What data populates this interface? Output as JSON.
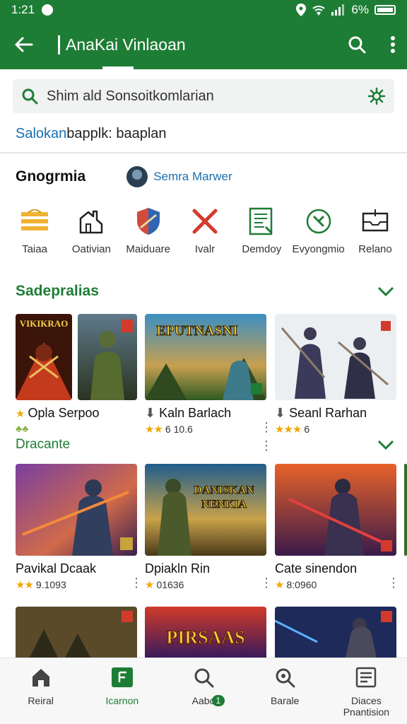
{
  "status": {
    "time": "1:21",
    "battery": "6%"
  },
  "appbar": {
    "title": "AnaKai Vinlaoan"
  },
  "search": {
    "text": "Shim ald Sonsoitkomlarian"
  },
  "suggestion": {
    "highlight": "Salokan",
    "rest": "bapplk: baaplan"
  },
  "genres": {
    "title": "Gnogrmia",
    "user": "Semra Marwer"
  },
  "categories": [
    {
      "label": "Taiaa",
      "icon": "stack-icon"
    },
    {
      "label": "Oativian",
      "icon": "building-icon"
    },
    {
      "label": "Maiduare",
      "icon": "shield-icon"
    },
    {
      "label": "Ivalr",
      "icon": "cross-swords-icon"
    },
    {
      "label": "Demdoy",
      "icon": "document-icon"
    },
    {
      "label": "Evyongmio",
      "icon": "circle-x-icon"
    },
    {
      "label": "Relano",
      "icon": "tray-icon"
    }
  ],
  "section1": {
    "title": "Sadepralias",
    "items": [
      {
        "title": "Opla Serpoo",
        "poster_text": "VIKIKRAO"
      },
      {
        "title": "Kaln Barlach",
        "rating": "6 10.6",
        "poster_text": "EPUTNASNI"
      },
      {
        "title": "Seanl Rarhan",
        "rating": "6"
      }
    ]
  },
  "section2": {
    "title": "Dracante",
    "items": [
      {
        "title": "Pavikal Dcaak",
        "rating": "9.1093"
      },
      {
        "title": "Dpiakln Rin",
        "rating": "01636",
        "poster_text_1": "DANISKAN",
        "poster_text_2": "NENKIA"
      },
      {
        "title": "Cate sinendon",
        "rating": "8:0960"
      }
    ]
  },
  "section3": {
    "poster_text": "PIRSAAS"
  },
  "nav": [
    {
      "label": "Reiral",
      "icon": "home-icon"
    },
    {
      "label": "Icarnon",
      "icon": "grid-icon"
    },
    {
      "label": "Aabo",
      "icon": "search-icon",
      "badge": "1"
    },
    {
      "label": "Barale",
      "icon": "zoom-icon"
    },
    {
      "label": "Diaces Pnantision",
      "icon": "list-icon"
    }
  ],
  "colors": {
    "brand": "#1e7d35",
    "accent": "#1a6fb0",
    "star": "#f2a800"
  }
}
